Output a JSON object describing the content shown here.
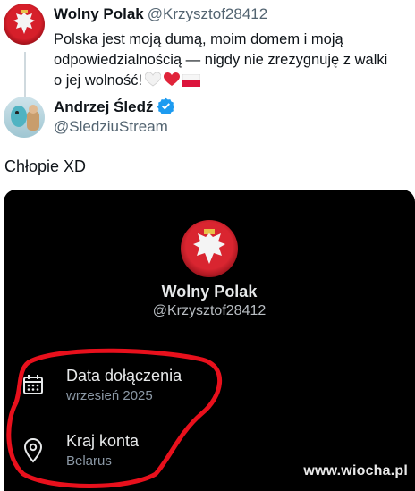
{
  "tweet": {
    "author_name": "Wolny Polak",
    "author_handle": "@Krzysztof28412",
    "text_line1": "Polska jest moją dumą, moim domem i moją",
    "text_line2": "odpowiedzialnością — nigdy nie zrezygnuję z walki",
    "text_line3": "o jej wolność!"
  },
  "quoted": {
    "name": "Andrzej Śledź",
    "handle": "@SledziuStream"
  },
  "reply": {
    "text": "Chłopie XD"
  },
  "profile_card": {
    "name": "Wolny Polak",
    "handle": "@Krzysztof28412",
    "rows": [
      {
        "title": "Data dołączenia",
        "value": "wrzesień 2025",
        "icon": "calendar-icon"
      },
      {
        "title": "Kraj konta",
        "value": "Belarus",
        "icon": "location-pin-icon"
      }
    ]
  },
  "watermark": "www.wiocha.pl",
  "colors": {
    "card_bg": "#000000",
    "highlight": "#e8101c",
    "verified": "#1d9bf0",
    "heart": "#e0243a"
  }
}
